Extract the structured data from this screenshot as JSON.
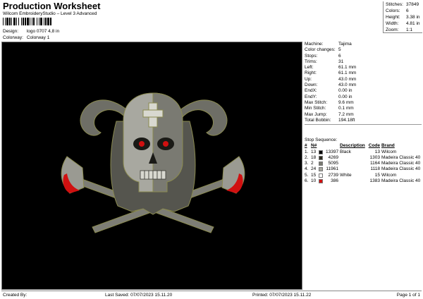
{
  "header": {
    "title": "Production Worksheet",
    "subtitle": "Wilcom EmbroideryStudio – Level 3 Advanced",
    "design_label": "Design:",
    "design_value": "logo 0707 4,8 in",
    "colorway_label": "Colorway:",
    "colorway_value": "Colorway 1"
  },
  "stats": [
    {
      "label": "Stitches:",
      "value": "37849"
    },
    {
      "label": "Colors:",
      "value": "6"
    },
    {
      "label": "Height:",
      "value": "3.38 in"
    },
    {
      "label": "Width:",
      "value": "4.81 in"
    },
    {
      "label": "Zoom:",
      "value": "1:1"
    }
  ],
  "info": [
    {
      "label": "Machine:",
      "value": "Tajima"
    },
    {
      "label": "Color changes:",
      "value": "5"
    },
    {
      "label": "Stops:",
      "value": "6"
    },
    {
      "label": "Trims:",
      "value": "31"
    },
    {
      "label": "Left:",
      "value": "61.1 mm"
    },
    {
      "label": "Right:",
      "value": "61.1 mm"
    },
    {
      "label": "Up:",
      "value": "43.0 mm"
    },
    {
      "label": "Down:",
      "value": "43.0 mm"
    },
    {
      "label": "EndX:",
      "value": "0.00 in"
    },
    {
      "label": "EndY:",
      "value": "0.00 in"
    },
    {
      "label": "Max Stitch:",
      "value": "9.6 mm"
    },
    {
      "label": "Min Stitch:",
      "value": "0.1 mm"
    },
    {
      "label": "Max Jump:",
      "value": "7.2 mm"
    },
    {
      "label": "Total Bobbin:",
      "value": "194.18ft"
    }
  ],
  "sequence": {
    "title": "Stop Sequence:",
    "columns": [
      "#",
      "N#",
      "",
      "Description",
      "Code",
      "Brand"
    ],
    "rows": [
      {
        "num": "1.",
        "n": "13",
        "color": "#000000",
        "stitches": "13397",
        "desc": "Black",
        "code": "13",
        "brand": "Wilcom"
      },
      {
        "num": "2.",
        "n": "18",
        "color": "#2e2c20",
        "stitches": "4269",
        "desc": "",
        "code": "1303",
        "brand": "Madeira Classic 40"
      },
      {
        "num": "3.",
        "n": "2",
        "color": "#7a7a72",
        "stitches": "5095",
        "desc": "",
        "code": "1164",
        "brand": "Madeira Classic 40"
      },
      {
        "num": "4.",
        "n": "24",
        "color": "#a8a8a0",
        "stitches": "11961",
        "desc": "",
        "code": "1118",
        "brand": "Madeira Classic 40"
      },
      {
        "num": "5.",
        "n": "15",
        "color": "#ffffff",
        "stitches": "2739",
        "desc": "White",
        "code": "15",
        "brand": "Wilcom"
      },
      {
        "num": "6.",
        "n": "10",
        "color": "#d01010",
        "stitches": "386",
        "desc": "",
        "code": "1383",
        "brand": "Madeira Classic 40"
      }
    ]
  },
  "footer": {
    "created_by": "Created By:",
    "last_saved": "Last Saved: 07/07/2023 15.11.20",
    "printed": "Printed: 07/07/2023 15.11.22",
    "page": "Page 1 of 1"
  },
  "colors": {
    "background": "#000000",
    "thread_red": "#d01010",
    "thread_gray": "#a8a8a0",
    "outline": "#8a8a50"
  }
}
